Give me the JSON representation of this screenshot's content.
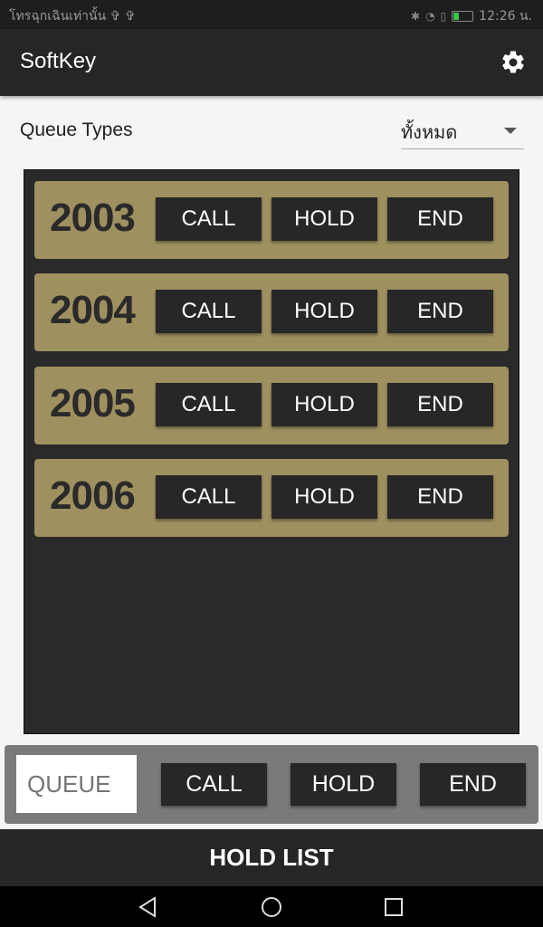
{
  "status_bar": {
    "left_text": "โทรฉุกเฉินเท่านั้น ✞ ✞",
    "time": "12:26 น."
  },
  "app_bar": {
    "title": "SoftKey",
    "settings_icon": "gear-icon"
  },
  "queue_types": {
    "label": "Queue Types",
    "selected": "ทั้งหมด"
  },
  "queues": [
    {
      "number": "2003",
      "call": "CALL",
      "hold": "HOLD",
      "end": "END"
    },
    {
      "number": "2004",
      "call": "CALL",
      "hold": "HOLD",
      "end": "END"
    },
    {
      "number": "2005",
      "call": "CALL",
      "hold": "HOLD",
      "end": "END"
    },
    {
      "number": "2006",
      "call": "CALL",
      "hold": "HOLD",
      "end": "END"
    }
  ],
  "bottom_controls": {
    "queue_placeholder": "QUEUE",
    "call": "CALL",
    "hold": "HOLD",
    "end": "END"
  },
  "hold_list_label": "HOLD LIST",
  "nav": {
    "back_icon": "back-icon",
    "home_icon": "home-icon",
    "recents_icon": "recents-icon"
  },
  "colors": {
    "row_background": "#9f9060",
    "panel_background": "#2a2a2a",
    "button_background": "#272727"
  }
}
